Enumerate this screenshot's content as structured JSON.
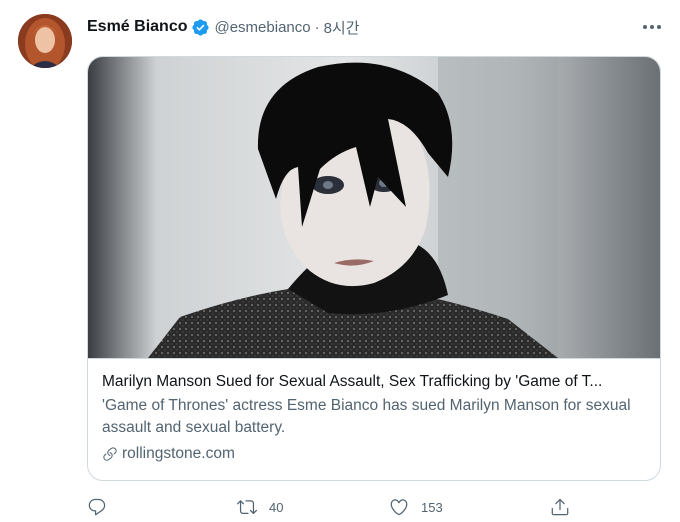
{
  "tweet": {
    "author": {
      "display_name": "Esmé Bianco",
      "handle": "@esmebianco",
      "separator": "·",
      "time": "8시간",
      "verified": true
    },
    "card": {
      "title": "Marilyn Manson Sued for Sexual Assault, Sex Trafficking by 'Game of T...",
      "description": "'Game of Thrones' actress Esme Bianco has sued Marilyn Manson for sexual assault and sexual battery.",
      "domain": "rollingstone.com"
    },
    "actions": {
      "reply_count": "",
      "retweet_count": "40",
      "like_count": "153"
    }
  },
  "colors": {
    "accent": "#1d9bf0",
    "muted": "#536471",
    "border": "#cfd9de"
  },
  "icons": [
    "verified-badge-icon",
    "more-icon",
    "link-icon",
    "reply-icon",
    "retweet-icon",
    "like-icon",
    "share-icon"
  ]
}
